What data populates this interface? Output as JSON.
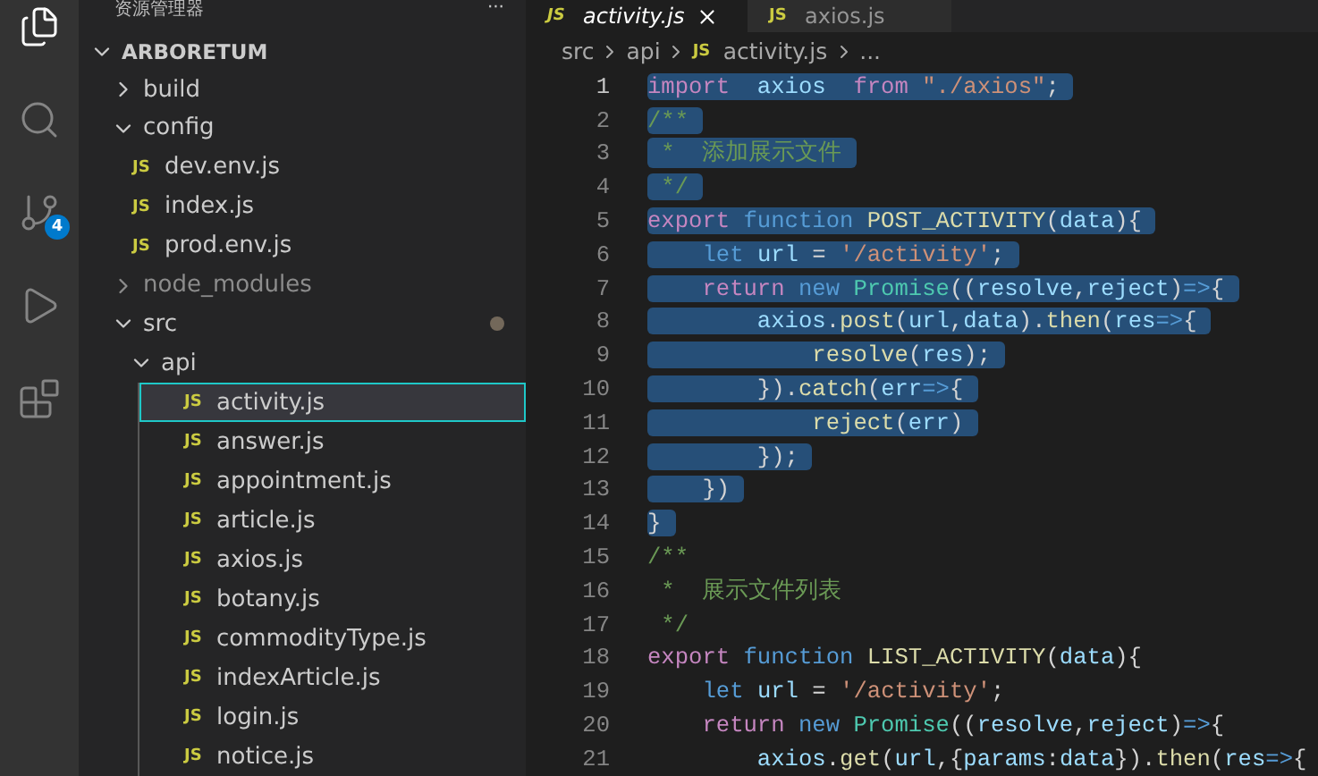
{
  "activity_bar": {
    "items": [
      {
        "kind": "files",
        "selected": true
      },
      {
        "kind": "search",
        "selected": false
      },
      {
        "kind": "source-control",
        "selected": false,
        "badge": "4"
      },
      {
        "kind": "run",
        "selected": false
      },
      {
        "kind": "extensions",
        "selected": false
      }
    ]
  },
  "sidebar": {
    "title": "资源管理器",
    "more": "···",
    "project": {
      "label": "ARBORETUM",
      "expanded": true
    },
    "items": [
      {
        "kind": "folder",
        "label": "build",
        "expanded": false,
        "ignored": false,
        "modified": false
      },
      {
        "kind": "folder",
        "label": "config",
        "expanded": true,
        "ignored": false,
        "modified": false,
        "children": [
          {
            "kind": "file",
            "icon_label": "JS",
            "label": "dev.env.js",
            "selected": false
          },
          {
            "kind": "file",
            "icon_label": "JS",
            "label": "index.js",
            "selected": false
          },
          {
            "kind": "file",
            "icon_label": "JS",
            "label": "prod.env.js",
            "selected": false
          }
        ]
      },
      {
        "kind": "folder",
        "label": "node_modules",
        "expanded": false,
        "ignored": true,
        "modified": false
      },
      {
        "kind": "folder",
        "label": "src",
        "expanded": true,
        "ignored": false,
        "modified": true,
        "children": [
          {
            "kind": "folder",
            "label": "api",
            "expanded": true,
            "ignored": false,
            "modified": false,
            "children": [
              {
                "kind": "file",
                "icon_label": "JS",
                "label": "activity.js",
                "selected": true
              },
              {
                "kind": "file",
                "icon_label": "JS",
                "label": "answer.js",
                "selected": false
              },
              {
                "kind": "file",
                "icon_label": "JS",
                "label": "appointment.js",
                "selected": false
              },
              {
                "kind": "file",
                "icon_label": "JS",
                "label": "article.js",
                "selected": false
              },
              {
                "kind": "file",
                "icon_label": "JS",
                "label": "axios.js",
                "selected": false
              },
              {
                "kind": "file",
                "icon_label": "JS",
                "label": "botany.js",
                "selected": false
              },
              {
                "kind": "file",
                "icon_label": "JS",
                "label": "commodityType.js",
                "selected": false
              },
              {
                "kind": "file",
                "icon_label": "JS",
                "label": "indexArticle.js",
                "selected": false
              },
              {
                "kind": "file",
                "icon_label": "JS",
                "label": "login.js",
                "selected": false
              },
              {
                "kind": "file",
                "icon_label": "JS",
                "label": "notice.js",
                "selected": false
              }
            ]
          }
        ]
      }
    ]
  },
  "tabs": [
    {
      "icon_label": "JS",
      "label": "activity.js",
      "selected": true,
      "preview": true
    },
    {
      "icon_label": "JS",
      "label": "axios.js",
      "selected": false,
      "preview": false
    }
  ],
  "breadcrumb": [
    {
      "kind": "text",
      "label": "src"
    },
    {
      "kind": "text",
      "label": "api"
    },
    {
      "kind": "file",
      "icon_label": "JS",
      "label": "activity.js"
    },
    {
      "kind": "text",
      "label": "..."
    }
  ],
  "code": [
    {
      "number": "1",
      "selected": true,
      "tokens": [
        {
          "text": "import",
          "kind": "keyword"
        },
        {
          "text": "  axios",
          "kind": "variable"
        },
        {
          "text": "  from",
          "kind": "keyword"
        },
        {
          "text": " \"./axios\"",
          "kind": "string"
        },
        {
          "text": ";",
          "kind": "plain"
        }
      ]
    },
    {
      "number": "2",
      "selected": true,
      "tokens": [
        {
          "text": "/**",
          "kind": "comment"
        }
      ]
    },
    {
      "number": "3",
      "selected": true,
      "tokens": [
        {
          "text": " *  添加展示文件",
          "kind": "comment"
        }
      ]
    },
    {
      "number": "4",
      "selected": true,
      "tokens": [
        {
          "text": " */",
          "kind": "comment"
        }
      ]
    },
    {
      "number": "5",
      "selected": true,
      "tokens": [
        {
          "text": "export",
          "kind": "keyword"
        },
        {
          "text": " function",
          "kind": "storage"
        },
        {
          "text": " POST_ACTIVITY",
          "kind": "function"
        },
        {
          "text": "(",
          "kind": "plain"
        },
        {
          "text": "data",
          "kind": "variable"
        },
        {
          "text": "){",
          "kind": "plain"
        }
      ]
    },
    {
      "number": "6",
      "selected": true,
      "tokens": [
        {
          "text": "    let",
          "kind": "storage"
        },
        {
          "text": " url",
          "kind": "variable"
        },
        {
          "text": " = ",
          "kind": "plain"
        },
        {
          "text": "'/activity'",
          "kind": "string"
        },
        {
          "text": ";",
          "kind": "plain"
        }
      ]
    },
    {
      "number": "7",
      "selected": true,
      "tokens": [
        {
          "text": "    return",
          "kind": "keyword"
        },
        {
          "text": " new",
          "kind": "storage"
        },
        {
          "text": " Promise",
          "kind": "class"
        },
        {
          "text": "((",
          "kind": "plain"
        },
        {
          "text": "resolve",
          "kind": "variable"
        },
        {
          "text": ",",
          "kind": "plain"
        },
        {
          "text": "reject",
          "kind": "variable"
        },
        {
          "text": ")",
          "kind": "plain"
        },
        {
          "text": "=>",
          "kind": "storage"
        },
        {
          "text": "{",
          "kind": "plain"
        }
      ]
    },
    {
      "number": "8",
      "selected": true,
      "tokens": [
        {
          "text": "        axios",
          "kind": "variable"
        },
        {
          "text": ".",
          "kind": "plain"
        },
        {
          "text": "post",
          "kind": "function"
        },
        {
          "text": "(",
          "kind": "plain"
        },
        {
          "text": "url",
          "kind": "variable"
        },
        {
          "text": ",",
          "kind": "plain"
        },
        {
          "text": "data",
          "kind": "variable"
        },
        {
          "text": ").",
          "kind": "plain"
        },
        {
          "text": "then",
          "kind": "function"
        },
        {
          "text": "(",
          "kind": "plain"
        },
        {
          "text": "res",
          "kind": "variable"
        },
        {
          "text": "=>",
          "kind": "storage"
        },
        {
          "text": "{",
          "kind": "plain"
        }
      ]
    },
    {
      "number": "9",
      "selected": true,
      "tokens": [
        {
          "text": "            resolve",
          "kind": "function"
        },
        {
          "text": "(",
          "kind": "plain"
        },
        {
          "text": "res",
          "kind": "variable"
        },
        {
          "text": ");",
          "kind": "plain"
        }
      ]
    },
    {
      "number": "10",
      "selected": true,
      "tokens": [
        {
          "text": "        }).",
          "kind": "plain"
        },
        {
          "text": "catch",
          "kind": "function"
        },
        {
          "text": "(",
          "kind": "plain"
        },
        {
          "text": "err",
          "kind": "variable"
        },
        {
          "text": "=>",
          "kind": "storage"
        },
        {
          "text": "{",
          "kind": "plain"
        }
      ]
    },
    {
      "number": "11",
      "selected": true,
      "tokens": [
        {
          "text": "            reject",
          "kind": "function"
        },
        {
          "text": "(",
          "kind": "plain"
        },
        {
          "text": "err",
          "kind": "variable"
        },
        {
          "text": ")",
          "kind": "plain"
        }
      ]
    },
    {
      "number": "12",
      "selected": true,
      "tokens": [
        {
          "text": "        });",
          "kind": "plain"
        }
      ]
    },
    {
      "number": "13",
      "selected": true,
      "tokens": [
        {
          "text": "    })",
          "kind": "plain"
        }
      ]
    },
    {
      "number": "14",
      "selected": true,
      "tokens": [
        {
          "text": "}",
          "kind": "plain"
        }
      ]
    },
    {
      "number": "15",
      "selected": false,
      "tokens": [
        {
          "text": "/**",
          "kind": "comment"
        }
      ]
    },
    {
      "number": "16",
      "selected": false,
      "tokens": [
        {
          "text": " *  展示文件列表",
          "kind": "comment"
        }
      ]
    },
    {
      "number": "17",
      "selected": false,
      "tokens": [
        {
          "text": " */",
          "kind": "comment"
        }
      ]
    },
    {
      "number": "18",
      "selected": false,
      "tokens": [
        {
          "text": "export",
          "kind": "keyword"
        },
        {
          "text": " function",
          "kind": "storage"
        },
        {
          "text": " LIST_ACTIVITY",
          "kind": "function"
        },
        {
          "text": "(",
          "kind": "plain"
        },
        {
          "text": "data",
          "kind": "variable"
        },
        {
          "text": "){",
          "kind": "plain"
        }
      ]
    },
    {
      "number": "19",
      "selected": false,
      "tokens": [
        {
          "text": "    let",
          "kind": "storage"
        },
        {
          "text": " url",
          "kind": "variable"
        },
        {
          "text": " = ",
          "kind": "plain"
        },
        {
          "text": "'/activity'",
          "kind": "string"
        },
        {
          "text": ";",
          "kind": "plain"
        }
      ]
    },
    {
      "number": "20",
      "selected": false,
      "tokens": [
        {
          "text": "    return",
          "kind": "keyword"
        },
        {
          "text": " new",
          "kind": "storage"
        },
        {
          "text": " Promise",
          "kind": "class"
        },
        {
          "text": "((",
          "kind": "plain"
        },
        {
          "text": "resolve",
          "kind": "variable"
        },
        {
          "text": ",",
          "kind": "plain"
        },
        {
          "text": "reject",
          "kind": "variable"
        },
        {
          "text": ")",
          "kind": "plain"
        },
        {
          "text": "=>",
          "kind": "storage"
        },
        {
          "text": "{",
          "kind": "plain"
        }
      ]
    },
    {
      "number": "21",
      "selected": false,
      "tokens": [
        {
          "text": "        axios",
          "kind": "variable"
        },
        {
          "text": ".",
          "kind": "plain"
        },
        {
          "text": "get",
          "kind": "function"
        },
        {
          "text": "(",
          "kind": "plain"
        },
        {
          "text": "url",
          "kind": "variable"
        },
        {
          "text": ",{",
          "kind": "plain"
        },
        {
          "text": "params",
          "kind": "variable"
        },
        {
          "text": ":",
          "kind": "plain"
        },
        {
          "text": "data",
          "kind": "variable"
        },
        {
          "text": "}).",
          "kind": "plain"
        },
        {
          "text": "then",
          "kind": "function"
        },
        {
          "text": "(",
          "kind": "plain"
        },
        {
          "text": "res",
          "kind": "variable"
        },
        {
          "text": "=>",
          "kind": "storage"
        },
        {
          "text": "{",
          "kind": "plain"
        }
      ]
    }
  ]
}
